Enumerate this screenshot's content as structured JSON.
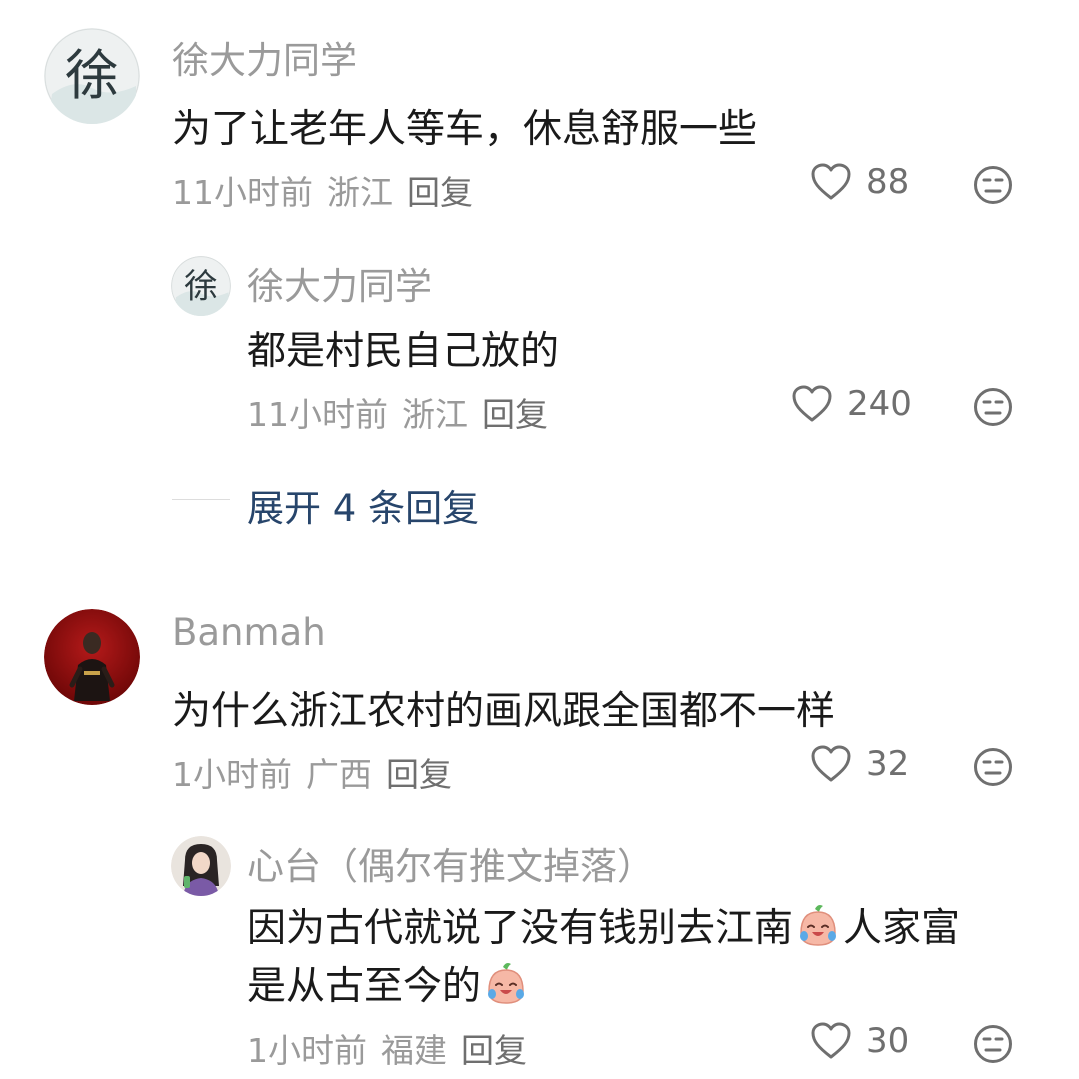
{
  "comments": [
    {
      "name": "徐大力同学",
      "text": "为了让老年人等车，休息舒服一些",
      "time": "11小时前",
      "location": "浙江",
      "reply_label": "回复",
      "likes": "88",
      "avatar_glyph": "徐"
    },
    {
      "name": "徐大力同学",
      "text": "都是村民自己放的",
      "time": "11小时前",
      "location": "浙江",
      "reply_label": "回复",
      "likes": "240",
      "avatar_glyph": "徐"
    },
    {
      "name": "Banmah",
      "text": "为什么浙江农村的画风跟全国都不一样",
      "time": "1小时前",
      "location": "广西",
      "reply_label": "回复",
      "likes": "32"
    },
    {
      "name": "心台（偶尔有推文掉落）",
      "text_line1_a": "因为古代就说了没有钱别去江南",
      "text_line1_b": "人家富",
      "text_line2": "是从古至今的",
      "time": "1小时前",
      "location": "福建",
      "reply_label": "回复",
      "likes": "30"
    }
  ],
  "expand_replies": "展开 4 条回复",
  "icons": {
    "like": "heart-outline-icon",
    "dislike": "meh-face-icon",
    "emoji": "crying-laughing-sticker-icon"
  },
  "colors": {
    "name": "#9a9a9a",
    "text": "#1a1a1a",
    "meta": "#9a9a9a",
    "expand": "#27456b",
    "icon": "#6f6f6f"
  }
}
